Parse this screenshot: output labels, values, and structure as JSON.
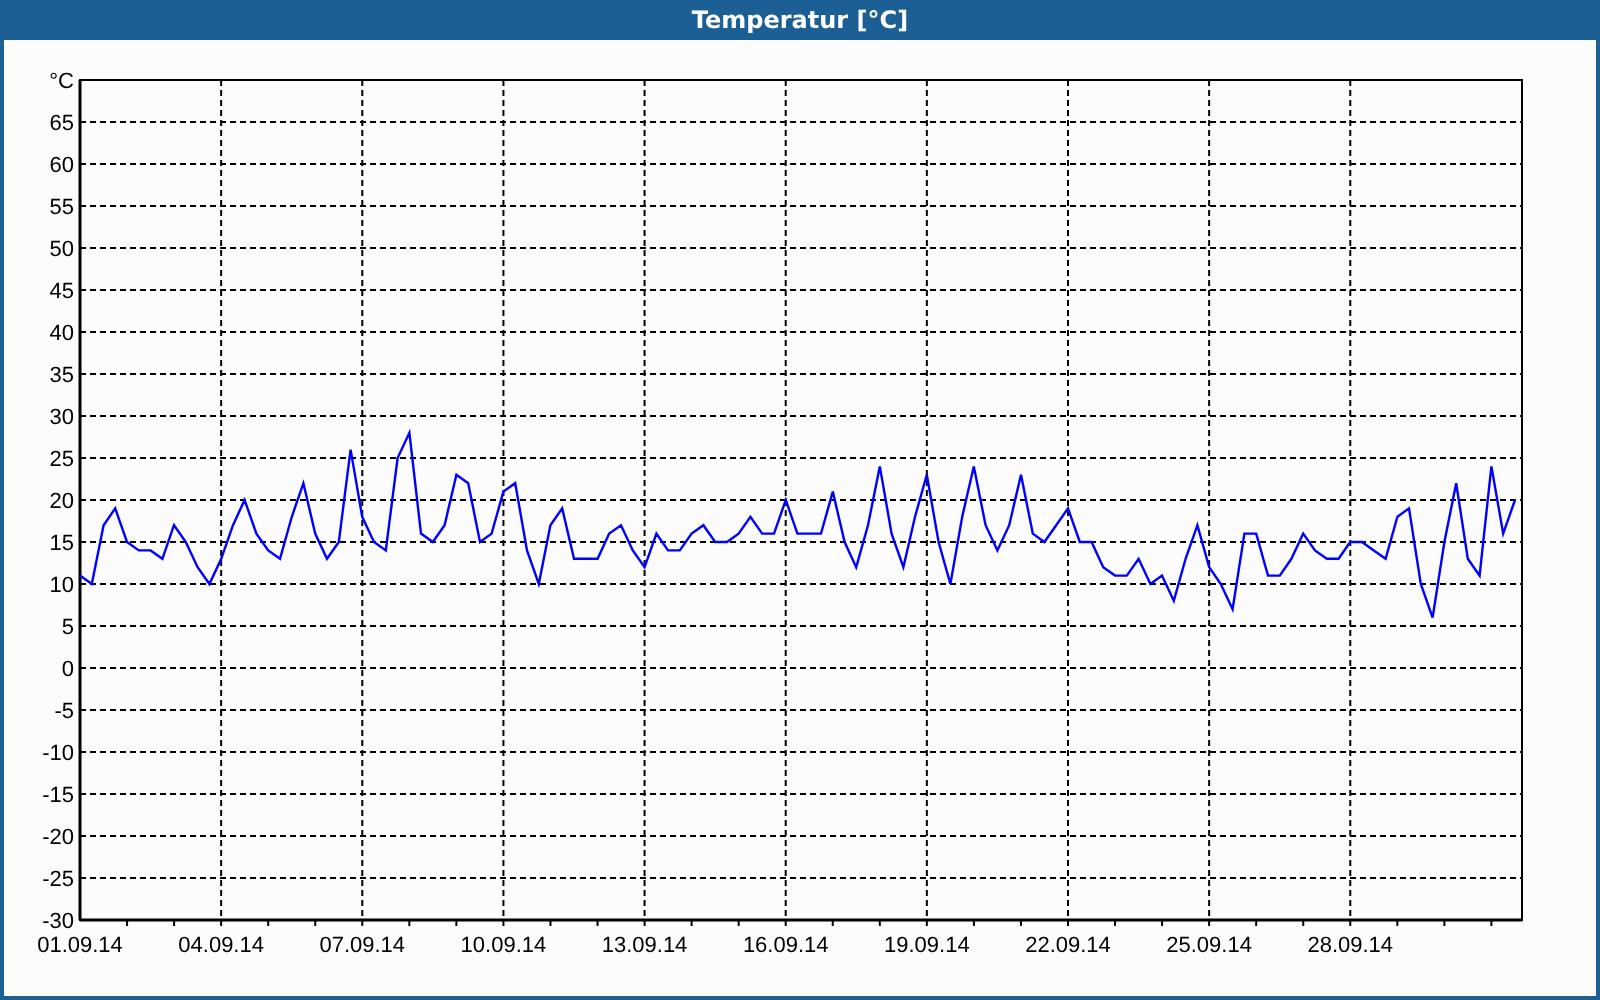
{
  "window": {
    "title": "Temperatur [°C]"
  },
  "chart": {
    "chart_data": {
      "type": "line",
      "ylabel": "°C",
      "grid": true,
      "ylim": [
        -30,
        70
      ],
      "yticks": [
        -30,
        -25,
        -20,
        -15,
        -10,
        -5,
        0,
        5,
        10,
        15,
        20,
        25,
        30,
        35,
        40,
        45,
        50,
        55,
        60,
        65
      ],
      "categories": [
        "01.09.14",
        null,
        null,
        null,
        null,
        null,
        null,
        null,
        null,
        null,
        null,
        null,
        "04.09.14",
        null,
        null,
        null,
        null,
        null,
        null,
        null,
        null,
        null,
        null,
        null,
        "07.09.14",
        null,
        null,
        null,
        null,
        null,
        null,
        null,
        null,
        null,
        null,
        null,
        "10.09.14",
        null,
        null,
        null,
        null,
        null,
        null,
        null,
        null,
        null,
        null,
        null,
        "13.09.14",
        null,
        null,
        null,
        null,
        null,
        null,
        null,
        null,
        null,
        null,
        null,
        "16.09.14",
        null,
        null,
        null,
        null,
        null,
        null,
        null,
        null,
        null,
        null,
        null,
        "19.09.14",
        null,
        null,
        null,
        null,
        null,
        null,
        null,
        null,
        null,
        null,
        null,
        "22.09.14",
        null,
        null,
        null,
        null,
        null,
        null,
        null,
        null,
        null,
        null,
        null,
        "25.09.14",
        null,
        null,
        null,
        null,
        null,
        null,
        null,
        null,
        null,
        null,
        null,
        "28.09.14",
        null,
        null,
        null,
        null,
        null,
        null,
        null,
        null,
        null,
        null,
        null,
        null,
        null,
        null
      ],
      "series": [
        {
          "color": "#0000ff",
          "values": [
            11,
            10,
            17,
            19,
            15,
            14,
            14,
            13,
            17,
            15,
            12,
            10,
            13,
            17,
            20,
            16,
            14,
            13,
            18,
            22,
            16,
            13,
            15,
            26,
            18,
            15,
            14,
            25,
            28,
            16,
            15,
            17,
            23,
            22,
            15,
            16,
            21,
            22,
            14,
            10,
            17,
            19,
            13,
            13,
            13,
            16,
            17,
            14,
            12,
            16,
            14,
            14,
            16,
            17,
            15,
            15,
            16,
            18,
            16,
            16,
            20,
            16,
            16,
            16,
            21,
            15,
            12,
            17,
            24,
            16,
            12,
            18,
            23,
            15,
            10,
            18,
            24,
            17,
            14,
            17,
            23,
            16,
            15,
            17,
            19,
            15,
            15,
            12,
            11,
            11,
            13,
            10,
            11,
            8,
            13,
            17,
            12,
            10,
            7,
            16,
            16,
            11,
            11,
            13,
            16,
            14,
            13,
            13,
            15,
            15,
            14,
            13,
            18,
            19,
            10,
            6,
            15,
            22,
            13,
            11,
            24,
            16,
            20
          ]
        }
      ]
    }
  }
}
